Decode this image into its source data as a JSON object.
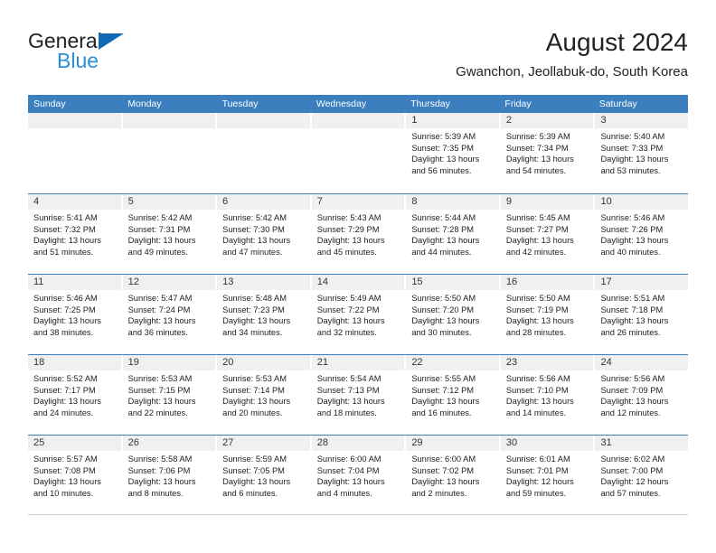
{
  "brand": {
    "name_top": "General",
    "name_bottom": "Blue",
    "accent_dark": "#1268b3",
    "accent_light": "#2a8fd4"
  },
  "header": {
    "title": "August 2024",
    "subtitle": "Gwanchon, Jeollabuk-do, South Korea"
  },
  "theme": {
    "header_band": "#3b7fbf",
    "date_band": "#f0f0f0",
    "row_divider": "#3b7fbf"
  },
  "weekdays": [
    "Sunday",
    "Monday",
    "Tuesday",
    "Wednesday",
    "Thursday",
    "Friday",
    "Saturday"
  ],
  "weeks": [
    [
      {
        "day": "",
        "empty": true,
        "sunrise": "",
        "sunset": "",
        "daylight_line1": "",
        "daylight_line2": ""
      },
      {
        "day": "",
        "empty": true,
        "sunrise": "",
        "sunset": "",
        "daylight_line1": "",
        "daylight_line2": ""
      },
      {
        "day": "",
        "empty": true,
        "sunrise": "",
        "sunset": "",
        "daylight_line1": "",
        "daylight_line2": ""
      },
      {
        "day": "",
        "empty": true,
        "sunrise": "",
        "sunset": "",
        "daylight_line1": "",
        "daylight_line2": ""
      },
      {
        "day": "1",
        "empty": false,
        "sunrise": "Sunrise: 5:39 AM",
        "sunset": "Sunset: 7:35 PM",
        "daylight_line1": "Daylight: 13 hours",
        "daylight_line2": "and 56 minutes."
      },
      {
        "day": "2",
        "empty": false,
        "sunrise": "Sunrise: 5:39 AM",
        "sunset": "Sunset: 7:34 PM",
        "daylight_line1": "Daylight: 13 hours",
        "daylight_line2": "and 54 minutes."
      },
      {
        "day": "3",
        "empty": false,
        "sunrise": "Sunrise: 5:40 AM",
        "sunset": "Sunset: 7:33 PM",
        "daylight_line1": "Daylight: 13 hours",
        "daylight_line2": "and 53 minutes."
      }
    ],
    [
      {
        "day": "4",
        "empty": false,
        "sunrise": "Sunrise: 5:41 AM",
        "sunset": "Sunset: 7:32 PM",
        "daylight_line1": "Daylight: 13 hours",
        "daylight_line2": "and 51 minutes."
      },
      {
        "day": "5",
        "empty": false,
        "sunrise": "Sunrise: 5:42 AM",
        "sunset": "Sunset: 7:31 PM",
        "daylight_line1": "Daylight: 13 hours",
        "daylight_line2": "and 49 minutes."
      },
      {
        "day": "6",
        "empty": false,
        "sunrise": "Sunrise: 5:42 AM",
        "sunset": "Sunset: 7:30 PM",
        "daylight_line1": "Daylight: 13 hours",
        "daylight_line2": "and 47 minutes."
      },
      {
        "day": "7",
        "empty": false,
        "sunrise": "Sunrise: 5:43 AM",
        "sunset": "Sunset: 7:29 PM",
        "daylight_line1": "Daylight: 13 hours",
        "daylight_line2": "and 45 minutes."
      },
      {
        "day": "8",
        "empty": false,
        "sunrise": "Sunrise: 5:44 AM",
        "sunset": "Sunset: 7:28 PM",
        "daylight_line1": "Daylight: 13 hours",
        "daylight_line2": "and 44 minutes."
      },
      {
        "day": "9",
        "empty": false,
        "sunrise": "Sunrise: 5:45 AM",
        "sunset": "Sunset: 7:27 PM",
        "daylight_line1": "Daylight: 13 hours",
        "daylight_line2": "and 42 minutes."
      },
      {
        "day": "10",
        "empty": false,
        "sunrise": "Sunrise: 5:46 AM",
        "sunset": "Sunset: 7:26 PM",
        "daylight_line1": "Daylight: 13 hours",
        "daylight_line2": "and 40 minutes."
      }
    ],
    [
      {
        "day": "11",
        "empty": false,
        "sunrise": "Sunrise: 5:46 AM",
        "sunset": "Sunset: 7:25 PM",
        "daylight_line1": "Daylight: 13 hours",
        "daylight_line2": "and 38 minutes."
      },
      {
        "day": "12",
        "empty": false,
        "sunrise": "Sunrise: 5:47 AM",
        "sunset": "Sunset: 7:24 PM",
        "daylight_line1": "Daylight: 13 hours",
        "daylight_line2": "and 36 minutes."
      },
      {
        "day": "13",
        "empty": false,
        "sunrise": "Sunrise: 5:48 AM",
        "sunset": "Sunset: 7:23 PM",
        "daylight_line1": "Daylight: 13 hours",
        "daylight_line2": "and 34 minutes."
      },
      {
        "day": "14",
        "empty": false,
        "sunrise": "Sunrise: 5:49 AM",
        "sunset": "Sunset: 7:22 PM",
        "daylight_line1": "Daylight: 13 hours",
        "daylight_line2": "and 32 minutes."
      },
      {
        "day": "15",
        "empty": false,
        "sunrise": "Sunrise: 5:50 AM",
        "sunset": "Sunset: 7:20 PM",
        "daylight_line1": "Daylight: 13 hours",
        "daylight_line2": "and 30 minutes."
      },
      {
        "day": "16",
        "empty": false,
        "sunrise": "Sunrise: 5:50 AM",
        "sunset": "Sunset: 7:19 PM",
        "daylight_line1": "Daylight: 13 hours",
        "daylight_line2": "and 28 minutes."
      },
      {
        "day": "17",
        "empty": false,
        "sunrise": "Sunrise: 5:51 AM",
        "sunset": "Sunset: 7:18 PM",
        "daylight_line1": "Daylight: 13 hours",
        "daylight_line2": "and 26 minutes."
      }
    ],
    [
      {
        "day": "18",
        "empty": false,
        "sunrise": "Sunrise: 5:52 AM",
        "sunset": "Sunset: 7:17 PM",
        "daylight_line1": "Daylight: 13 hours",
        "daylight_line2": "and 24 minutes."
      },
      {
        "day": "19",
        "empty": false,
        "sunrise": "Sunrise: 5:53 AM",
        "sunset": "Sunset: 7:15 PM",
        "daylight_line1": "Daylight: 13 hours",
        "daylight_line2": "and 22 minutes."
      },
      {
        "day": "20",
        "empty": false,
        "sunrise": "Sunrise: 5:53 AM",
        "sunset": "Sunset: 7:14 PM",
        "daylight_line1": "Daylight: 13 hours",
        "daylight_line2": "and 20 minutes."
      },
      {
        "day": "21",
        "empty": false,
        "sunrise": "Sunrise: 5:54 AM",
        "sunset": "Sunset: 7:13 PM",
        "daylight_line1": "Daylight: 13 hours",
        "daylight_line2": "and 18 minutes."
      },
      {
        "day": "22",
        "empty": false,
        "sunrise": "Sunrise: 5:55 AM",
        "sunset": "Sunset: 7:12 PM",
        "daylight_line1": "Daylight: 13 hours",
        "daylight_line2": "and 16 minutes."
      },
      {
        "day": "23",
        "empty": false,
        "sunrise": "Sunrise: 5:56 AM",
        "sunset": "Sunset: 7:10 PM",
        "daylight_line1": "Daylight: 13 hours",
        "daylight_line2": "and 14 minutes."
      },
      {
        "day": "24",
        "empty": false,
        "sunrise": "Sunrise: 5:56 AM",
        "sunset": "Sunset: 7:09 PM",
        "daylight_line1": "Daylight: 13 hours",
        "daylight_line2": "and 12 minutes."
      }
    ],
    [
      {
        "day": "25",
        "empty": false,
        "sunrise": "Sunrise: 5:57 AM",
        "sunset": "Sunset: 7:08 PM",
        "daylight_line1": "Daylight: 13 hours",
        "daylight_line2": "and 10 minutes."
      },
      {
        "day": "26",
        "empty": false,
        "sunrise": "Sunrise: 5:58 AM",
        "sunset": "Sunset: 7:06 PM",
        "daylight_line1": "Daylight: 13 hours",
        "daylight_line2": "and 8 minutes."
      },
      {
        "day": "27",
        "empty": false,
        "sunrise": "Sunrise: 5:59 AM",
        "sunset": "Sunset: 7:05 PM",
        "daylight_line1": "Daylight: 13 hours",
        "daylight_line2": "and 6 minutes."
      },
      {
        "day": "28",
        "empty": false,
        "sunrise": "Sunrise: 6:00 AM",
        "sunset": "Sunset: 7:04 PM",
        "daylight_line1": "Daylight: 13 hours",
        "daylight_line2": "and 4 minutes."
      },
      {
        "day": "29",
        "empty": false,
        "sunrise": "Sunrise: 6:00 AM",
        "sunset": "Sunset: 7:02 PM",
        "daylight_line1": "Daylight: 13 hours",
        "daylight_line2": "and 2 minutes."
      },
      {
        "day": "30",
        "empty": false,
        "sunrise": "Sunrise: 6:01 AM",
        "sunset": "Sunset: 7:01 PM",
        "daylight_line1": "Daylight: 12 hours",
        "daylight_line2": "and 59 minutes."
      },
      {
        "day": "31",
        "empty": false,
        "sunrise": "Sunrise: 6:02 AM",
        "sunset": "Sunset: 7:00 PM",
        "daylight_line1": "Daylight: 12 hours",
        "daylight_line2": "and 57 minutes."
      }
    ]
  ]
}
